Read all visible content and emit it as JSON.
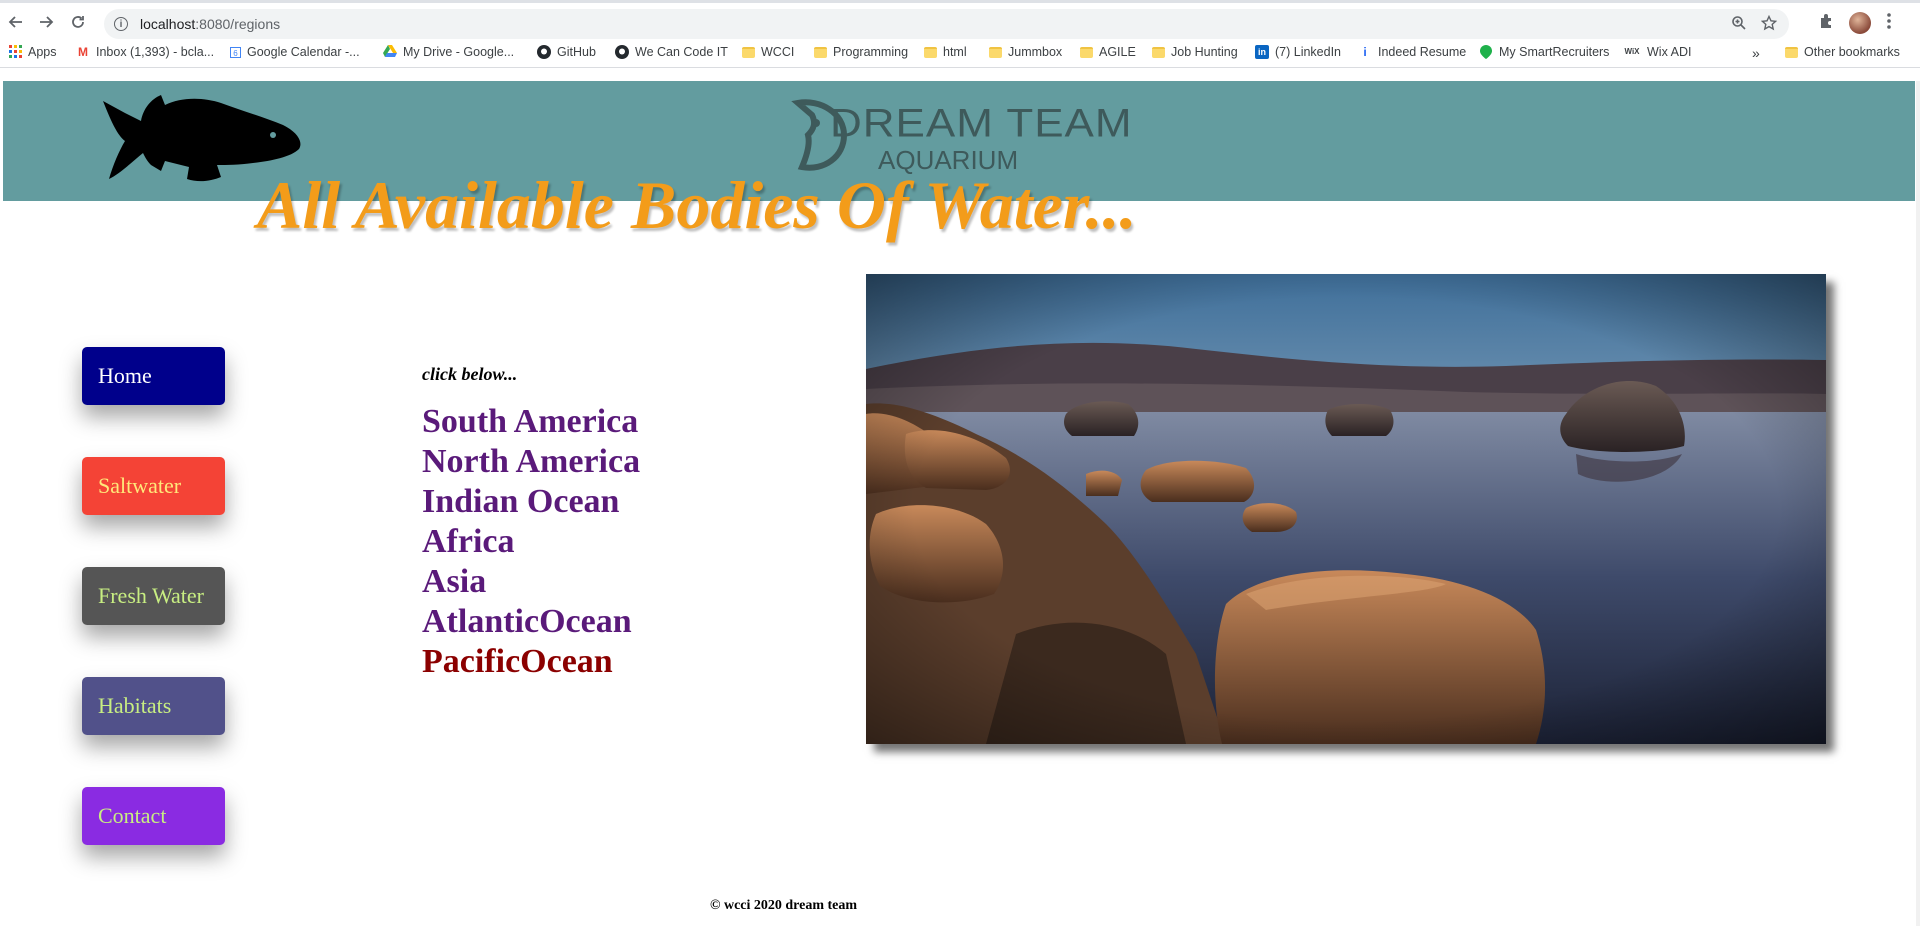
{
  "browser": {
    "url_host": "localhost",
    "url_path": ":8080/regions",
    "bookmarks": [
      {
        "label": "Apps",
        "icon": "apps-grid-icon"
      },
      {
        "label": "Inbox (1,393) - bcla...",
        "icon": "gmail-icon"
      },
      {
        "label": "Google Calendar -...",
        "icon": "calendar-icon"
      },
      {
        "label": "My Drive - Google...",
        "icon": "drive-icon"
      },
      {
        "label": "GitHub",
        "icon": "github-icon"
      },
      {
        "label": "We Can Code IT",
        "icon": "github-icon"
      },
      {
        "label": "WCCI",
        "icon": "folder-icon"
      },
      {
        "label": "Programming",
        "icon": "folder-icon"
      },
      {
        "label": "html",
        "icon": "folder-icon"
      },
      {
        "label": "Jummbox",
        "icon": "folder-icon"
      },
      {
        "label": "AGILE",
        "icon": "folder-icon"
      },
      {
        "label": "Job Hunting",
        "icon": "folder-icon"
      },
      {
        "label": "(7) LinkedIn",
        "icon": "linkedin-icon"
      },
      {
        "label": "Indeed Resume",
        "icon": "indeed-icon"
      },
      {
        "label": "My SmartRecruiters",
        "icon": "smartrecruiters-icon"
      },
      {
        "label": "Wix ADI",
        "icon": "wix-icon"
      }
    ],
    "overflow_label": "»",
    "other_bookmarks": "Other bookmarks"
  },
  "header": {
    "logo_line1": "DREAM TEAM",
    "logo_line2": "AQUARIUM",
    "title": "All Available Bodies Of Water..."
  },
  "sidebar": {
    "home": "Home",
    "saltwater": "Saltwater",
    "freshwater": "Fresh Water",
    "habitats": "Habitats",
    "contact": "Contact"
  },
  "main": {
    "instruction": "click below...",
    "regions": [
      "South America",
      "North America",
      "Indian Ocean",
      "Africa",
      "Asia",
      "AtlanticOcean",
      "PacificOcean"
    ]
  },
  "footer": {
    "text": "© wcci 2020 dream team"
  },
  "colors": {
    "header_band": "#639c9f",
    "title": "#f39c1a",
    "link": "#5a1a7a",
    "visited_link": "#8b0000"
  }
}
